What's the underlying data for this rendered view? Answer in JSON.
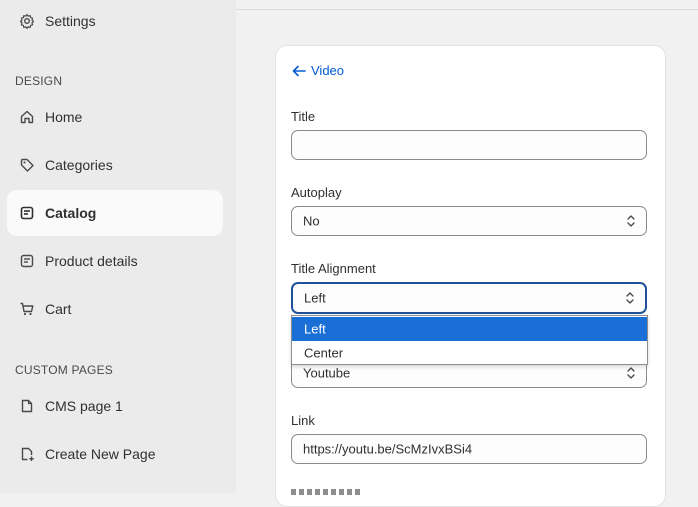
{
  "sidebar": {
    "settings_label": "Settings",
    "design_heading": "DESIGN",
    "items": [
      {
        "label": "Home",
        "icon": "home-icon"
      },
      {
        "label": "Categories",
        "icon": "tag-icon"
      },
      {
        "label": "Catalog",
        "icon": "catalog-icon"
      },
      {
        "label": "Product details",
        "icon": "product-icon"
      },
      {
        "label": "Cart",
        "icon": "cart-icon"
      }
    ],
    "custom_heading": "CUSTOM PAGES",
    "pages": [
      {
        "label": "CMS page 1",
        "icon": "page-icon"
      },
      {
        "label": "Create New Page",
        "icon": "new-page-icon"
      }
    ],
    "active": "Catalog"
  },
  "editor": {
    "back_label": "Video",
    "fields": {
      "title": {
        "label": "Title",
        "value": ""
      },
      "autoplay": {
        "label": "Autoplay",
        "value": "No"
      },
      "title_alignment": {
        "label": "Title Alignment",
        "value": "Left",
        "options": [
          "Left",
          "Center"
        ]
      },
      "source": {
        "value": "Youtube"
      },
      "link": {
        "label": "Link",
        "value": "https://youtu.be/ScMzIvxBSi4"
      }
    }
  },
  "colors": {
    "accent": "#005bd3",
    "selected_option": "#1a6fd6",
    "sidebar_bg": "#ebebeb",
    "active_item_bg": "#fafafa"
  }
}
